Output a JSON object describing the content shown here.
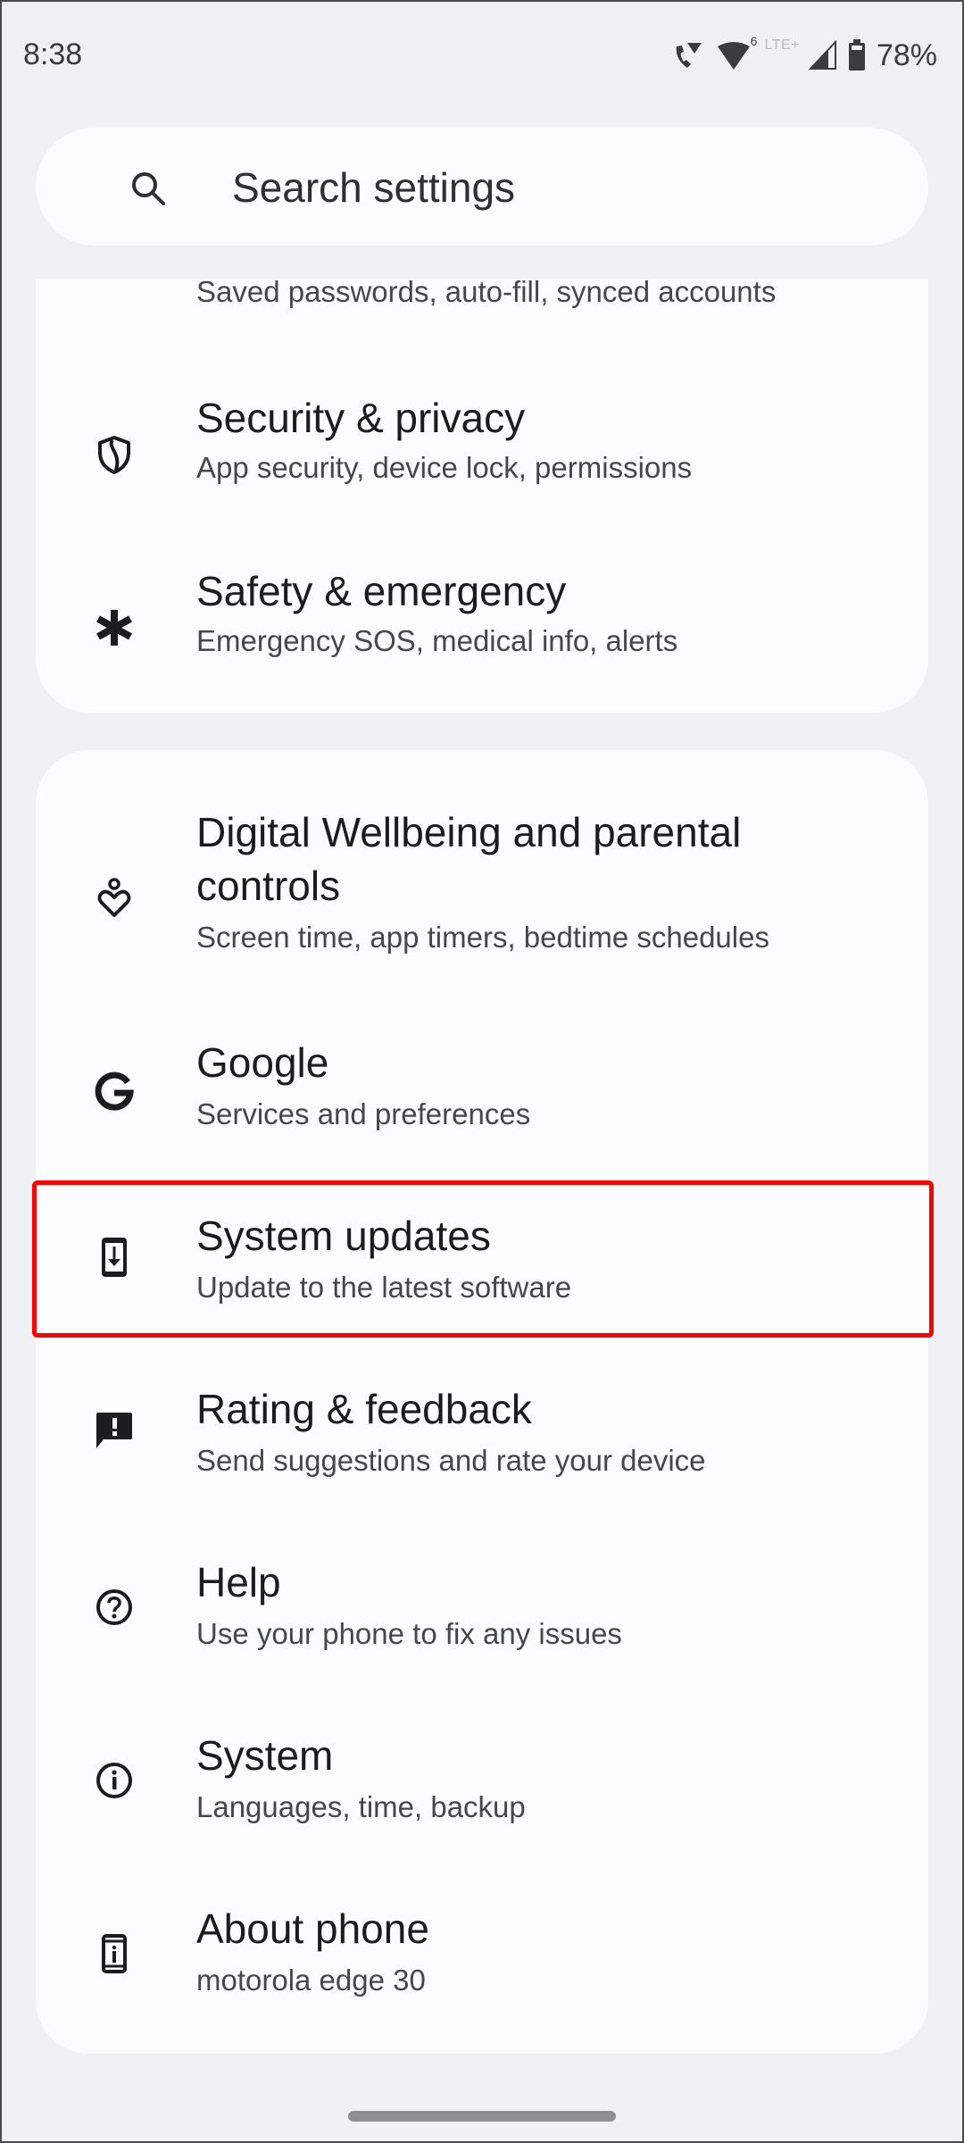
{
  "status_bar": {
    "time": "8:38",
    "icons": [
      "wifi-calling-icon",
      "wifi-6-icon",
      "lte-plus-indicator",
      "cell-signal-icon",
      "battery-icon"
    ],
    "network_label": "LTE+",
    "wifi_badge": "6",
    "battery_percent": "78%"
  },
  "search": {
    "placeholder": "Search settings",
    "icon": "search-icon"
  },
  "card_1": {
    "items": [
      {
        "title": "",
        "subtitle": "Saved passwords, auto-fill, synced accounts",
        "icon": "passwords-accounts-icon"
      },
      {
        "title": "Security & privacy",
        "subtitle": "App security, device lock, permissions",
        "icon": "shield-icon"
      },
      {
        "title": "Safety & emergency",
        "subtitle": "Emergency SOS, medical info, alerts",
        "icon": "asterisk-medical-icon"
      }
    ]
  },
  "card_2": {
    "items": [
      {
        "title_line1": "Digital Wellbeing and parental",
        "title_line2": "controls",
        "subtitle": "Screen time, app timers, bedtime schedules",
        "icon": "wellbeing-heart-icon"
      },
      {
        "title": "Google",
        "subtitle": "Services and preferences",
        "icon": "google-g-icon"
      },
      {
        "title": "System updates",
        "subtitle": "Update to the latest software",
        "icon": "system-update-icon",
        "highlighted": true
      },
      {
        "title": "Rating & feedback",
        "subtitle": "Send suggestions and rate your device",
        "icon": "feedback-icon"
      },
      {
        "title": "Help",
        "subtitle": "Use your phone to fix any issues",
        "icon": "help-icon"
      },
      {
        "title": "System",
        "subtitle": "Languages, time, backup",
        "icon": "info-icon"
      },
      {
        "title": "About phone",
        "subtitle": "motorola edge 30",
        "icon": "about-phone-icon"
      }
    ]
  },
  "colors": {
    "background": "#eff1f4",
    "card": "#fbfcfe",
    "title_text": "#1b1c1f",
    "subtitle_text": "#44474e",
    "highlight_border": "#ff0000",
    "home_indicator": "#8e8e93"
  }
}
